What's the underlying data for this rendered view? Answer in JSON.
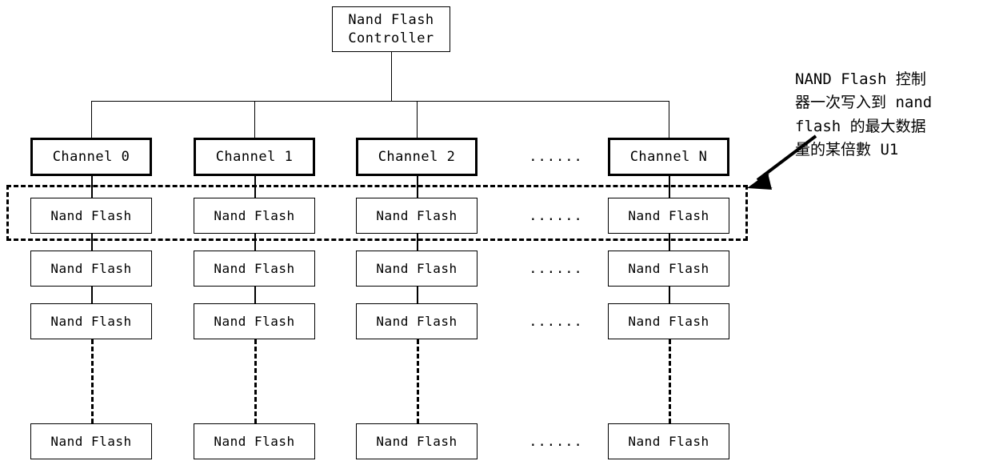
{
  "diagram": {
    "title_box": {
      "label": "Nand Flash\nController",
      "name": "nand-flash-controller-box"
    },
    "channels": [
      {
        "label": "Channel 0"
      },
      {
        "label": "Channel 1"
      },
      {
        "label": "Channel 2"
      },
      {
        "label": "Channel N"
      }
    ],
    "ellipsis": "......",
    "flash_label": "Nand Flash",
    "flash_rows": [
      {
        "cells": [
          "Nand Flash",
          "Nand Flash",
          "Nand Flash",
          "Nand Flash"
        ],
        "ellipsis": "......"
      },
      {
        "cells": [
          "Nand Flash",
          "Nand Flash",
          "Nand Flash",
          "Nand Flash"
        ],
        "ellipsis": "......"
      },
      {
        "cells": [
          "Nand Flash",
          "Nand Flash",
          "Nand Flash",
          "Nand Flash"
        ],
        "ellipsis": "......"
      },
      {
        "cells": [
          "Nand Flash",
          "Nand Flash",
          "Nand Flash",
          "Nand Flash"
        ],
        "ellipsis": "......"
      }
    ],
    "annotation": {
      "text": "NAND Flash 控制\n器一次写入到 nand\nflash 的最大数据\n量的某倍數 U1"
    },
    "colors": {
      "line": "#000000",
      "box_fill": "#ffffff",
      "text": "#000000",
      "background": "#ffffff"
    }
  }
}
